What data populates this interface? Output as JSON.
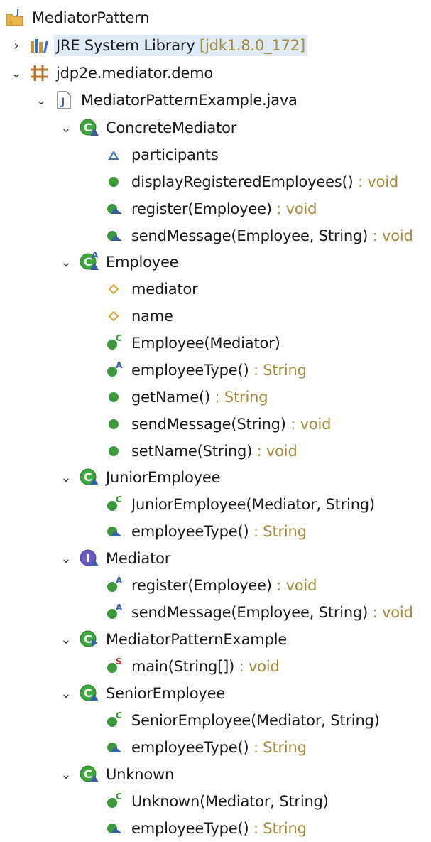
{
  "project": {
    "name": "MediatorPattern",
    "jre": {
      "label": "JRE System Library",
      "decoration": "[jdk1.8.0_172]"
    },
    "package": "jdp2e.mediator.demo",
    "file": "MediatorPatternExample.java"
  },
  "nodes": [
    {
      "id": "concrete-mediator",
      "label": "ConcreteMediator",
      "type": "",
      "icon": "class-icon"
    },
    {
      "id": "participants",
      "label": "participants",
      "type": "",
      "icon": "field-protected-icon"
    },
    {
      "id": "display-registered",
      "label": "displayRegisteredEmployees()",
      "type": " : void",
      "icon": "method-public-icon"
    },
    {
      "id": "cm-register",
      "label": "register(Employee)",
      "type": " : void",
      "icon": "method-override-icon"
    },
    {
      "id": "cm-send",
      "label": "sendMessage(Employee, String)",
      "type": " : void",
      "icon": "method-override-icon"
    },
    {
      "id": "employee",
      "label": "Employee",
      "type": "",
      "icon": "abstract-class-icon"
    },
    {
      "id": "mediator-field",
      "label": "mediator",
      "type": "",
      "icon": "field-default-icon"
    },
    {
      "id": "name-field",
      "label": "name",
      "type": "",
      "icon": "field-default-icon"
    },
    {
      "id": "employee-ctor",
      "label": "Employee(Mediator)",
      "type": "",
      "icon": "constructor-icon"
    },
    {
      "id": "employee-type-abstract",
      "label": "employeeType()",
      "type": " : String",
      "icon": "method-abstract-icon"
    },
    {
      "id": "get-name",
      "label": "getName()",
      "type": " : String",
      "icon": "method-public-icon"
    },
    {
      "id": "emp-send",
      "label": "sendMessage(String)",
      "type": " : void",
      "icon": "method-public-icon"
    },
    {
      "id": "set-name",
      "label": "setName(String)",
      "type": " : void",
      "icon": "method-public-icon"
    },
    {
      "id": "junior",
      "label": "JuniorEmployee",
      "type": "",
      "icon": "class-icon"
    },
    {
      "id": "junior-ctor",
      "label": "JuniorEmployee(Mediator, String)",
      "type": "",
      "icon": "constructor-icon"
    },
    {
      "id": "junior-type",
      "label": "employeeType()",
      "type": " : String",
      "icon": "method-override-icon"
    },
    {
      "id": "mediator-iface",
      "label": "Mediator",
      "type": "",
      "icon": "interface-icon"
    },
    {
      "id": "med-register",
      "label": "register(Employee)",
      "type": " : void",
      "icon": "method-abstract-icon"
    },
    {
      "id": "med-send",
      "label": "sendMessage(Employee, String)",
      "type": " : void",
      "icon": "method-abstract-icon"
    },
    {
      "id": "mpe-class",
      "label": "MediatorPatternExample",
      "type": "",
      "icon": "main-class-icon"
    },
    {
      "id": "main",
      "label": "main(String[])",
      "type": " : void",
      "icon": "static-method-icon"
    },
    {
      "id": "senior",
      "label": "SeniorEmployee",
      "type": "",
      "icon": "class-icon"
    },
    {
      "id": "senior-ctor",
      "label": "SeniorEmployee(Mediator, String)",
      "type": "",
      "icon": "constructor-icon"
    },
    {
      "id": "senior-type",
      "label": "employeeType()",
      "type": " : String",
      "icon": "method-override-icon"
    },
    {
      "id": "unknown",
      "label": "Unknown",
      "type": "",
      "icon": "class-icon"
    },
    {
      "id": "unknown-ctor",
      "label": "Unknown(Mediator, String)",
      "type": "",
      "icon": "constructor-icon"
    },
    {
      "id": "unknown-type",
      "label": "employeeType()",
      "type": " : String",
      "icon": "method-override-icon"
    }
  ],
  "colors": {
    "type_suffix": "#a48b3c",
    "selection": "#dfeaf6",
    "public_method": "#3c9a3c",
    "class": "#3fa53f",
    "interface": "#6a5bbf"
  }
}
